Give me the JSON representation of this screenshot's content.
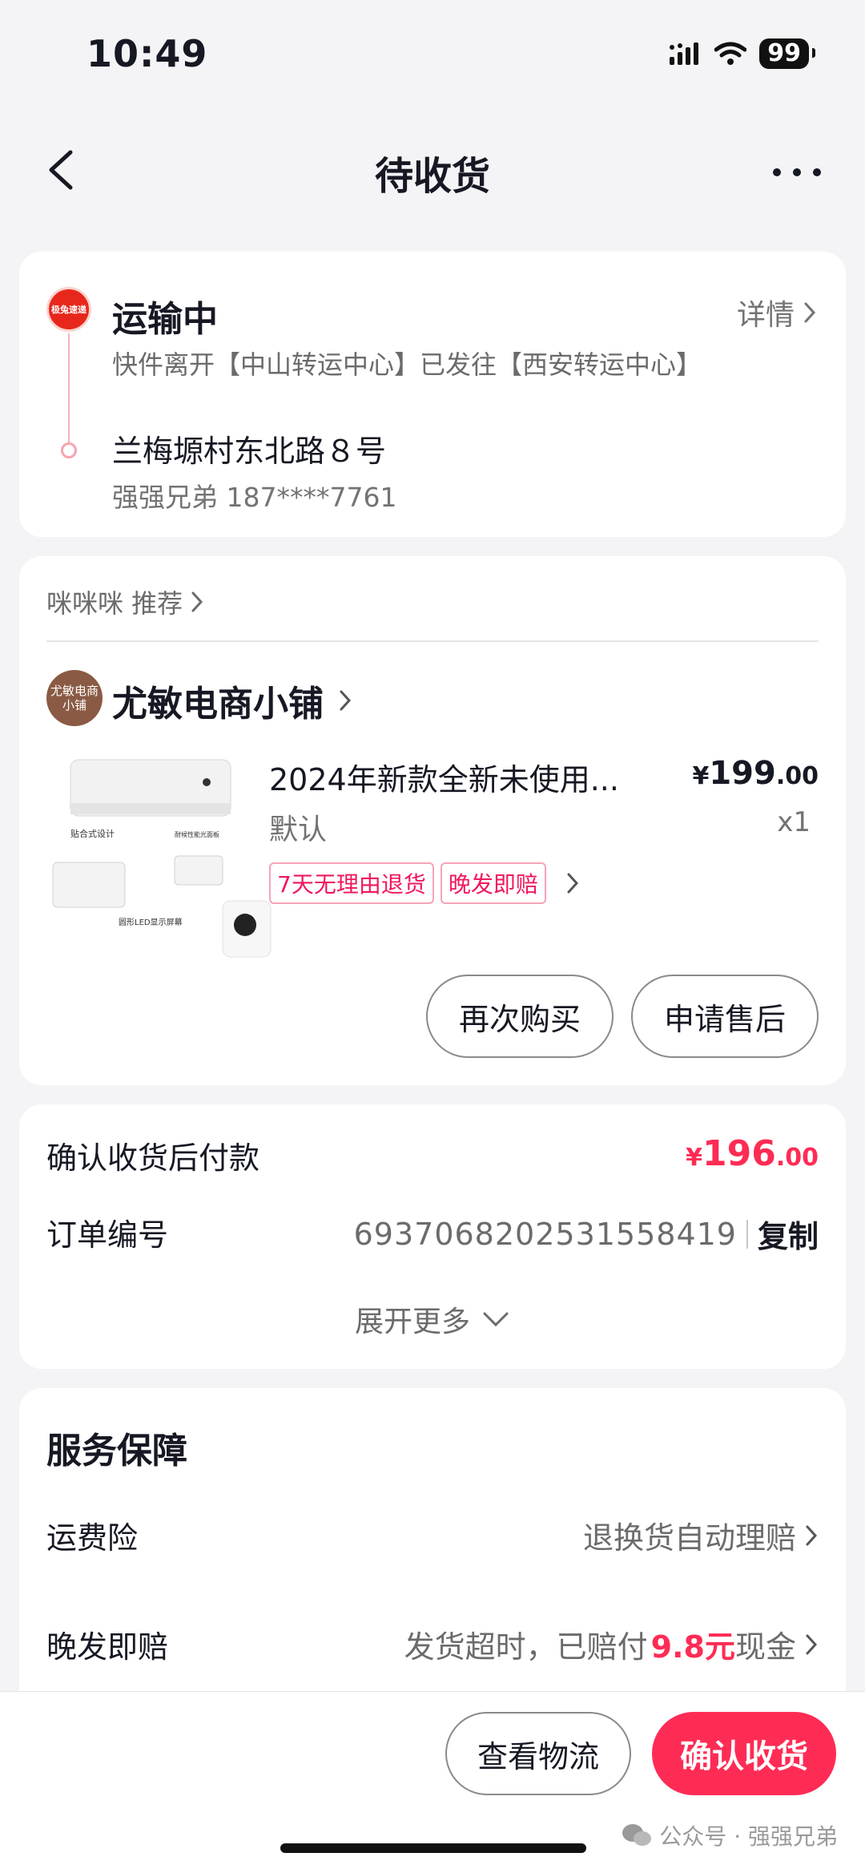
{
  "status_bar": {
    "time": "10:49",
    "battery": "99"
  },
  "nav": {
    "title": "待收货"
  },
  "logistics": {
    "courier_logo_text": "极兔速递",
    "status": "运输中",
    "detail_label": "详情",
    "description": "快件离开【中山转运中心】已发往【西安转运中心】",
    "address": "兰梅塬村东北路８号",
    "contact": "强强兄弟 187****7761"
  },
  "product_card": {
    "recommend_label": "咪咪咪 推荐",
    "shop_avatar_text": "尤敏电商小铺",
    "shop_name": "尤敏电商小铺",
    "product": {
      "title": "2024年新款全新未使用...",
      "price_currency": "¥",
      "price_int": "199",
      "price_dec": ".00",
      "spec": "默认",
      "quantity": "x1",
      "image_labels": [
        "贴合式设计",
        "耐候性能光面板",
        "圆形LED显示屏幕"
      ],
      "tags": [
        "7天无理由退货",
        "晚发即赔"
      ]
    },
    "buttons": {
      "rebuy": "再次购买",
      "after_sale": "申请售后"
    }
  },
  "payment": {
    "label": "确认收货后付款",
    "amount_currency": "¥",
    "amount_int": "196",
    "amount_dec": ".00",
    "order_label": "订单编号",
    "order_number": "6937068202531558419",
    "copy_label": "复制",
    "expand_label": "展开更多"
  },
  "service": {
    "title": "服务保障",
    "freight_label": "运费险",
    "freight_value": "退换货自动理赔",
    "late_label": "晚发即赔",
    "late_value_prefix": "发货超时，已赔付",
    "late_value_amount": "9.8元",
    "late_value_suffix": "现金"
  },
  "bottom_bar": {
    "view_logistics": "查看物流",
    "confirm_receipt": "确认收货"
  },
  "watermark": "公众号 · 强强兄弟",
  "colors": {
    "accent": "#fe2c55",
    "background": "#f4f4f6"
  }
}
